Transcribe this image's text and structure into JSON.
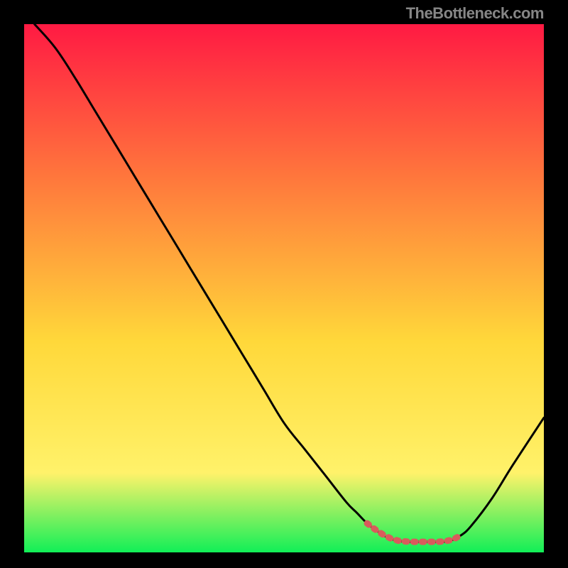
{
  "watermark_text": "TheBottleneck.com",
  "colors": {
    "frame": "#000000",
    "grad_top": "#ff1a43",
    "grad_mid1": "#ff7a3c",
    "grad_mid2": "#ffd83a",
    "grad_mid3": "#fff26a",
    "grad_bottom": "#11ef57",
    "curve": "#000000",
    "marker": "#d85c5c"
  },
  "chart_data": {
    "type": "line",
    "title": "",
    "xlabel": "",
    "ylabel": "",
    "xlim": [
      0,
      100
    ],
    "ylim": [
      0,
      100
    ],
    "x": [
      2,
      6,
      10,
      14,
      18,
      22,
      26,
      30,
      34,
      38,
      42,
      46,
      50,
      54,
      58,
      62,
      64,
      66,
      68,
      70,
      72,
      74,
      76,
      78,
      80,
      82,
      84,
      86,
      90,
      94,
      100
    ],
    "values": [
      100,
      95.5,
      89.5,
      83,
      76.5,
      70,
      63.5,
      57,
      50.5,
      44,
      37.5,
      31,
      24.5,
      19.5,
      14.5,
      9.5,
      7.5,
      5.5,
      4,
      2.8,
      2.2,
      2.0,
      2.0,
      2.0,
      2.0,
      2.2,
      3.2,
      5.0,
      10.2,
      16.5,
      25.5
    ],
    "marker_region_x": [
      66,
      84
    ],
    "green_band_y": 2.0
  }
}
